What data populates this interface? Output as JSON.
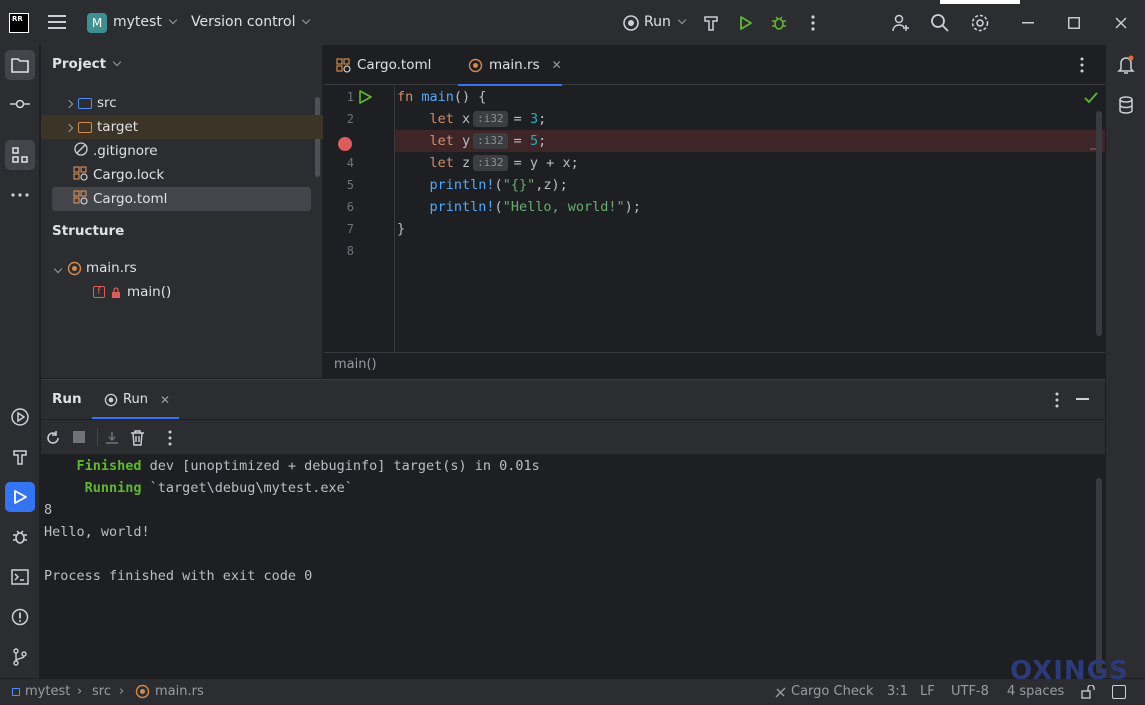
{
  "titlebar": {
    "project_badge": "M",
    "project_name": "mytest",
    "vcs_label": "Version control",
    "run_config": "Run"
  },
  "project_panel": {
    "title": "Project",
    "items": [
      {
        "label": "src",
        "type": "folder"
      },
      {
        "label": "target",
        "type": "folder"
      },
      {
        "label": ".gitignore",
        "type": "file"
      },
      {
        "label": "Cargo.lock",
        "type": "file"
      },
      {
        "label": "Cargo.toml",
        "type": "file"
      }
    ]
  },
  "structure_panel": {
    "title": "Structure",
    "file": "main.rs",
    "fn": "main()"
  },
  "editor": {
    "tabs": [
      {
        "label": "Cargo.toml"
      },
      {
        "label": "main.rs"
      }
    ],
    "line_numbers": [
      "1",
      "2",
      "3",
      "4",
      "5",
      "6",
      "7",
      "8"
    ],
    "type_hint": ":i32",
    "breadcrumb": "main()"
  },
  "run_panel": {
    "title": "Run",
    "tab_label": "Run",
    "output": {
      "finished_kw": "Finished",
      "finished_rest": " dev [unoptimized + debuginfo] target(s) in 0.01s",
      "running_kw": "Running",
      "running_rest": " `target\\debug\\mytest.exe`",
      "line3": "8",
      "line4": "Hello, world!",
      "line5": "Process finished with exit code 0"
    }
  },
  "statusbar": {
    "crumb_project": "mytest",
    "crumb_folder": "src",
    "crumb_file": "main.rs",
    "cargo_check": "Cargo Check",
    "position": "3:1",
    "line_sep": "LF",
    "encoding": "UTF-8",
    "indent": "4 spaces"
  },
  "watermark": "OXINGS",
  "colors": {
    "accent": "#3574f0",
    "breakpoint": "#db5c5c",
    "run_green": "#5fb832"
  }
}
